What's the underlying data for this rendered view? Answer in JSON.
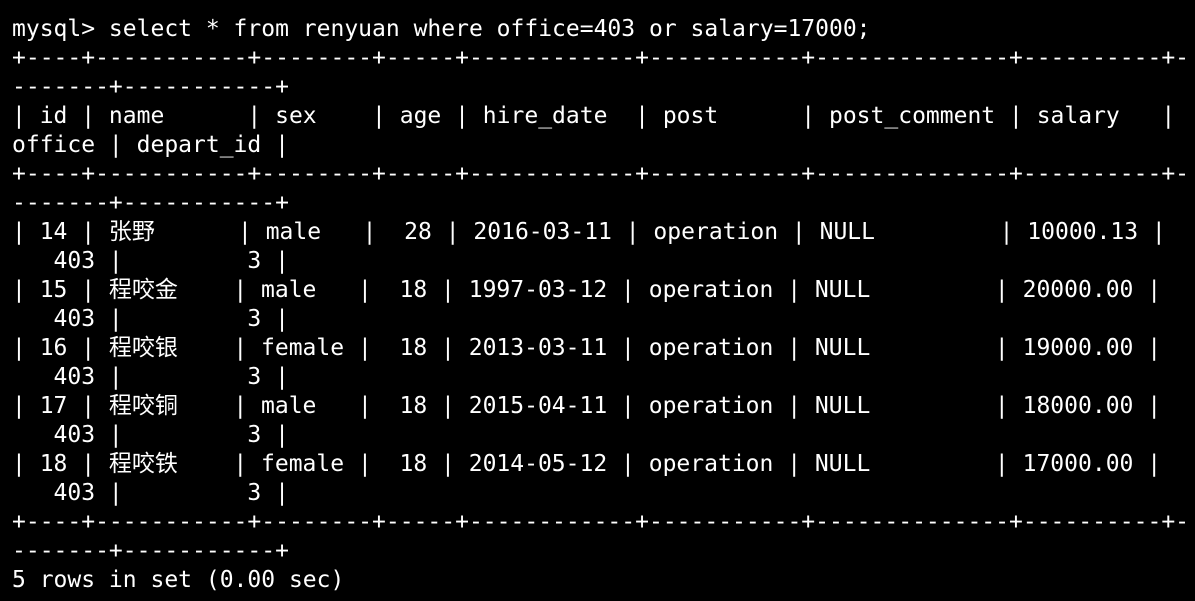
{
  "terminal": {
    "lines": [
      "mysql> select * from renyuan where office=403 or salary=17000;",
      "+----+-----------+--------+-----+------------+-----------+--------------+----------+-",
      "-------+-----------+",
      "| id | name      | sex    | age | hire_date  | post      | post_comment | salary   |",
      "office | depart_id |",
      "+----+-----------+--------+-----+------------+-----------+--------------+----------+-",
      "-------+-----------+",
      "| 14 | 张野      | male   |  28 | 2016-03-11 | operation | NULL         | 10000.13 |",
      "   403 |         3 |",
      "| 15 | 程咬金    | male   |  18 | 1997-03-12 | operation | NULL         | 20000.00 |",
      "   403 |         3 |",
      "| 16 | 程咬银    | female |  18 | 2013-03-11 | operation | NULL         | 19000.00 |",
      "   403 |         3 |",
      "| 17 | 程咬铜    | male   |  18 | 2015-04-11 | operation | NULL         | 18000.00 |",
      "   403 |         3 |",
      "| 18 | 程咬铁    | female |  18 | 2014-05-12 | operation | NULL         | 17000.00 |",
      "   403 |         3 |",
      "+----+-----------+--------+-----+------------+-----------+--------------+----------+-",
      "-------+-----------+",
      "5 rows in set (0.00 sec)"
    ]
  },
  "colors": {
    "background": "#000000",
    "text": "#ffffff"
  }
}
